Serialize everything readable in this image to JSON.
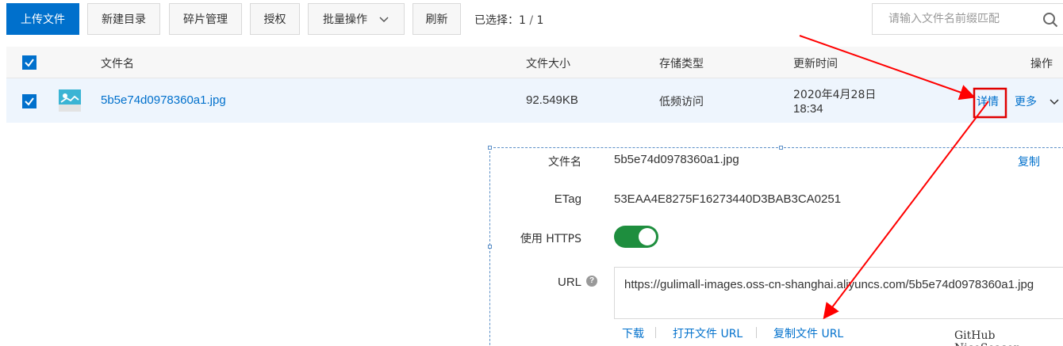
{
  "toolbar": {
    "upload_label": "上传文件",
    "new_dir_label": "新建目录",
    "fragment_label": "碎片管理",
    "auth_label": "授权",
    "batch_label": "批量操作",
    "refresh_label": "刷新",
    "selected_prefix": "已选择：",
    "selected_count": "1",
    "selected_sep": " / ",
    "selected_total": "1",
    "search_placeholder": "请输入文件名前缀匹配"
  },
  "table": {
    "columns": [
      "文件名",
      "文件大小",
      "存储类型",
      "更新时间",
      "操作"
    ],
    "rows": [
      {
        "name": "5b5e74d0978360a1.jpg",
        "size": "92.549KB",
        "storage": "低频访问",
        "updated_date": "2020年4月28日",
        "updated_time": "18:34",
        "details": "详情",
        "more": "更多"
      }
    ]
  },
  "detail": {
    "filename_label": "文件名",
    "filename_value": "5b5e74d0978360a1.jpg",
    "copy_label": "复制",
    "etag_label": "ETag",
    "etag_value": "53EAA4E8275F16273440D3BAB3CA0251",
    "https_label": "使用 HTTPS",
    "https_enabled": true,
    "url_label": "URL",
    "url_value": "https://gulimall-images.oss-cn-shanghai.aliyuncs.com/5b5e74d0978360a1.jpg",
    "download_label": "下载",
    "open_url_label": "打开文件 URL",
    "copy_url_label": "复制文件 URL"
  },
  "watermark": "GitHub NiceSeason",
  "colors": {
    "primary": "#0070cc",
    "toggle_on": "#1e8e3e",
    "annotation": "#ff0000"
  }
}
